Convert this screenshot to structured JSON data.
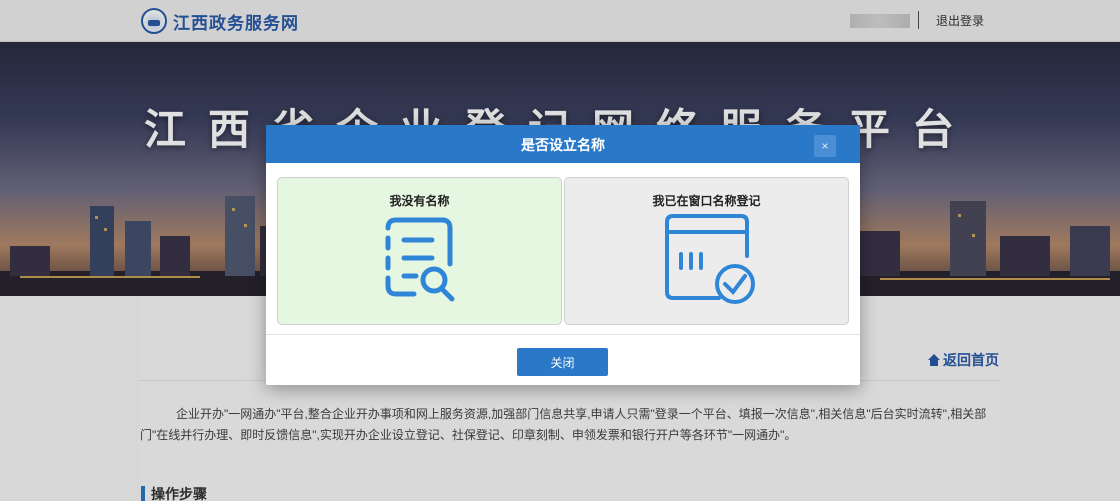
{
  "header": {
    "site_name": "江西政务服务网",
    "logout_label": "退出登录"
  },
  "banner": {
    "title": "江西省企业登记网络服务平台"
  },
  "main": {
    "home_link": "返回首页",
    "intro": "企业开办\"一网通办\"平台,整合企业开办事项和网上服务资源,加强部门信息共享,申请人只需\"登录一个平台、填报一次信息\",相关信息\"后台实时流转\",相关部门\"在线并行办理、即时反馈信息\",实现开办企业设立登记、社保登记、印章刻制、申领发票和银行开户等各环节\"一网通办\"。",
    "steps_heading": "操作步骤"
  },
  "modal": {
    "title": "是否设立名称",
    "close_icon": "×",
    "options": [
      {
        "label": "我没有名称",
        "icon": "list-search-icon"
      },
      {
        "label": "我已在窗口名称登记",
        "icon": "calendar-check-icon"
      }
    ],
    "close_button": "关闭"
  },
  "colors": {
    "primary": "#2a78c8",
    "brand": "#2a5ca8",
    "option_selected_bg": "#e6f7e1",
    "option_default_bg": "#ececec"
  }
}
